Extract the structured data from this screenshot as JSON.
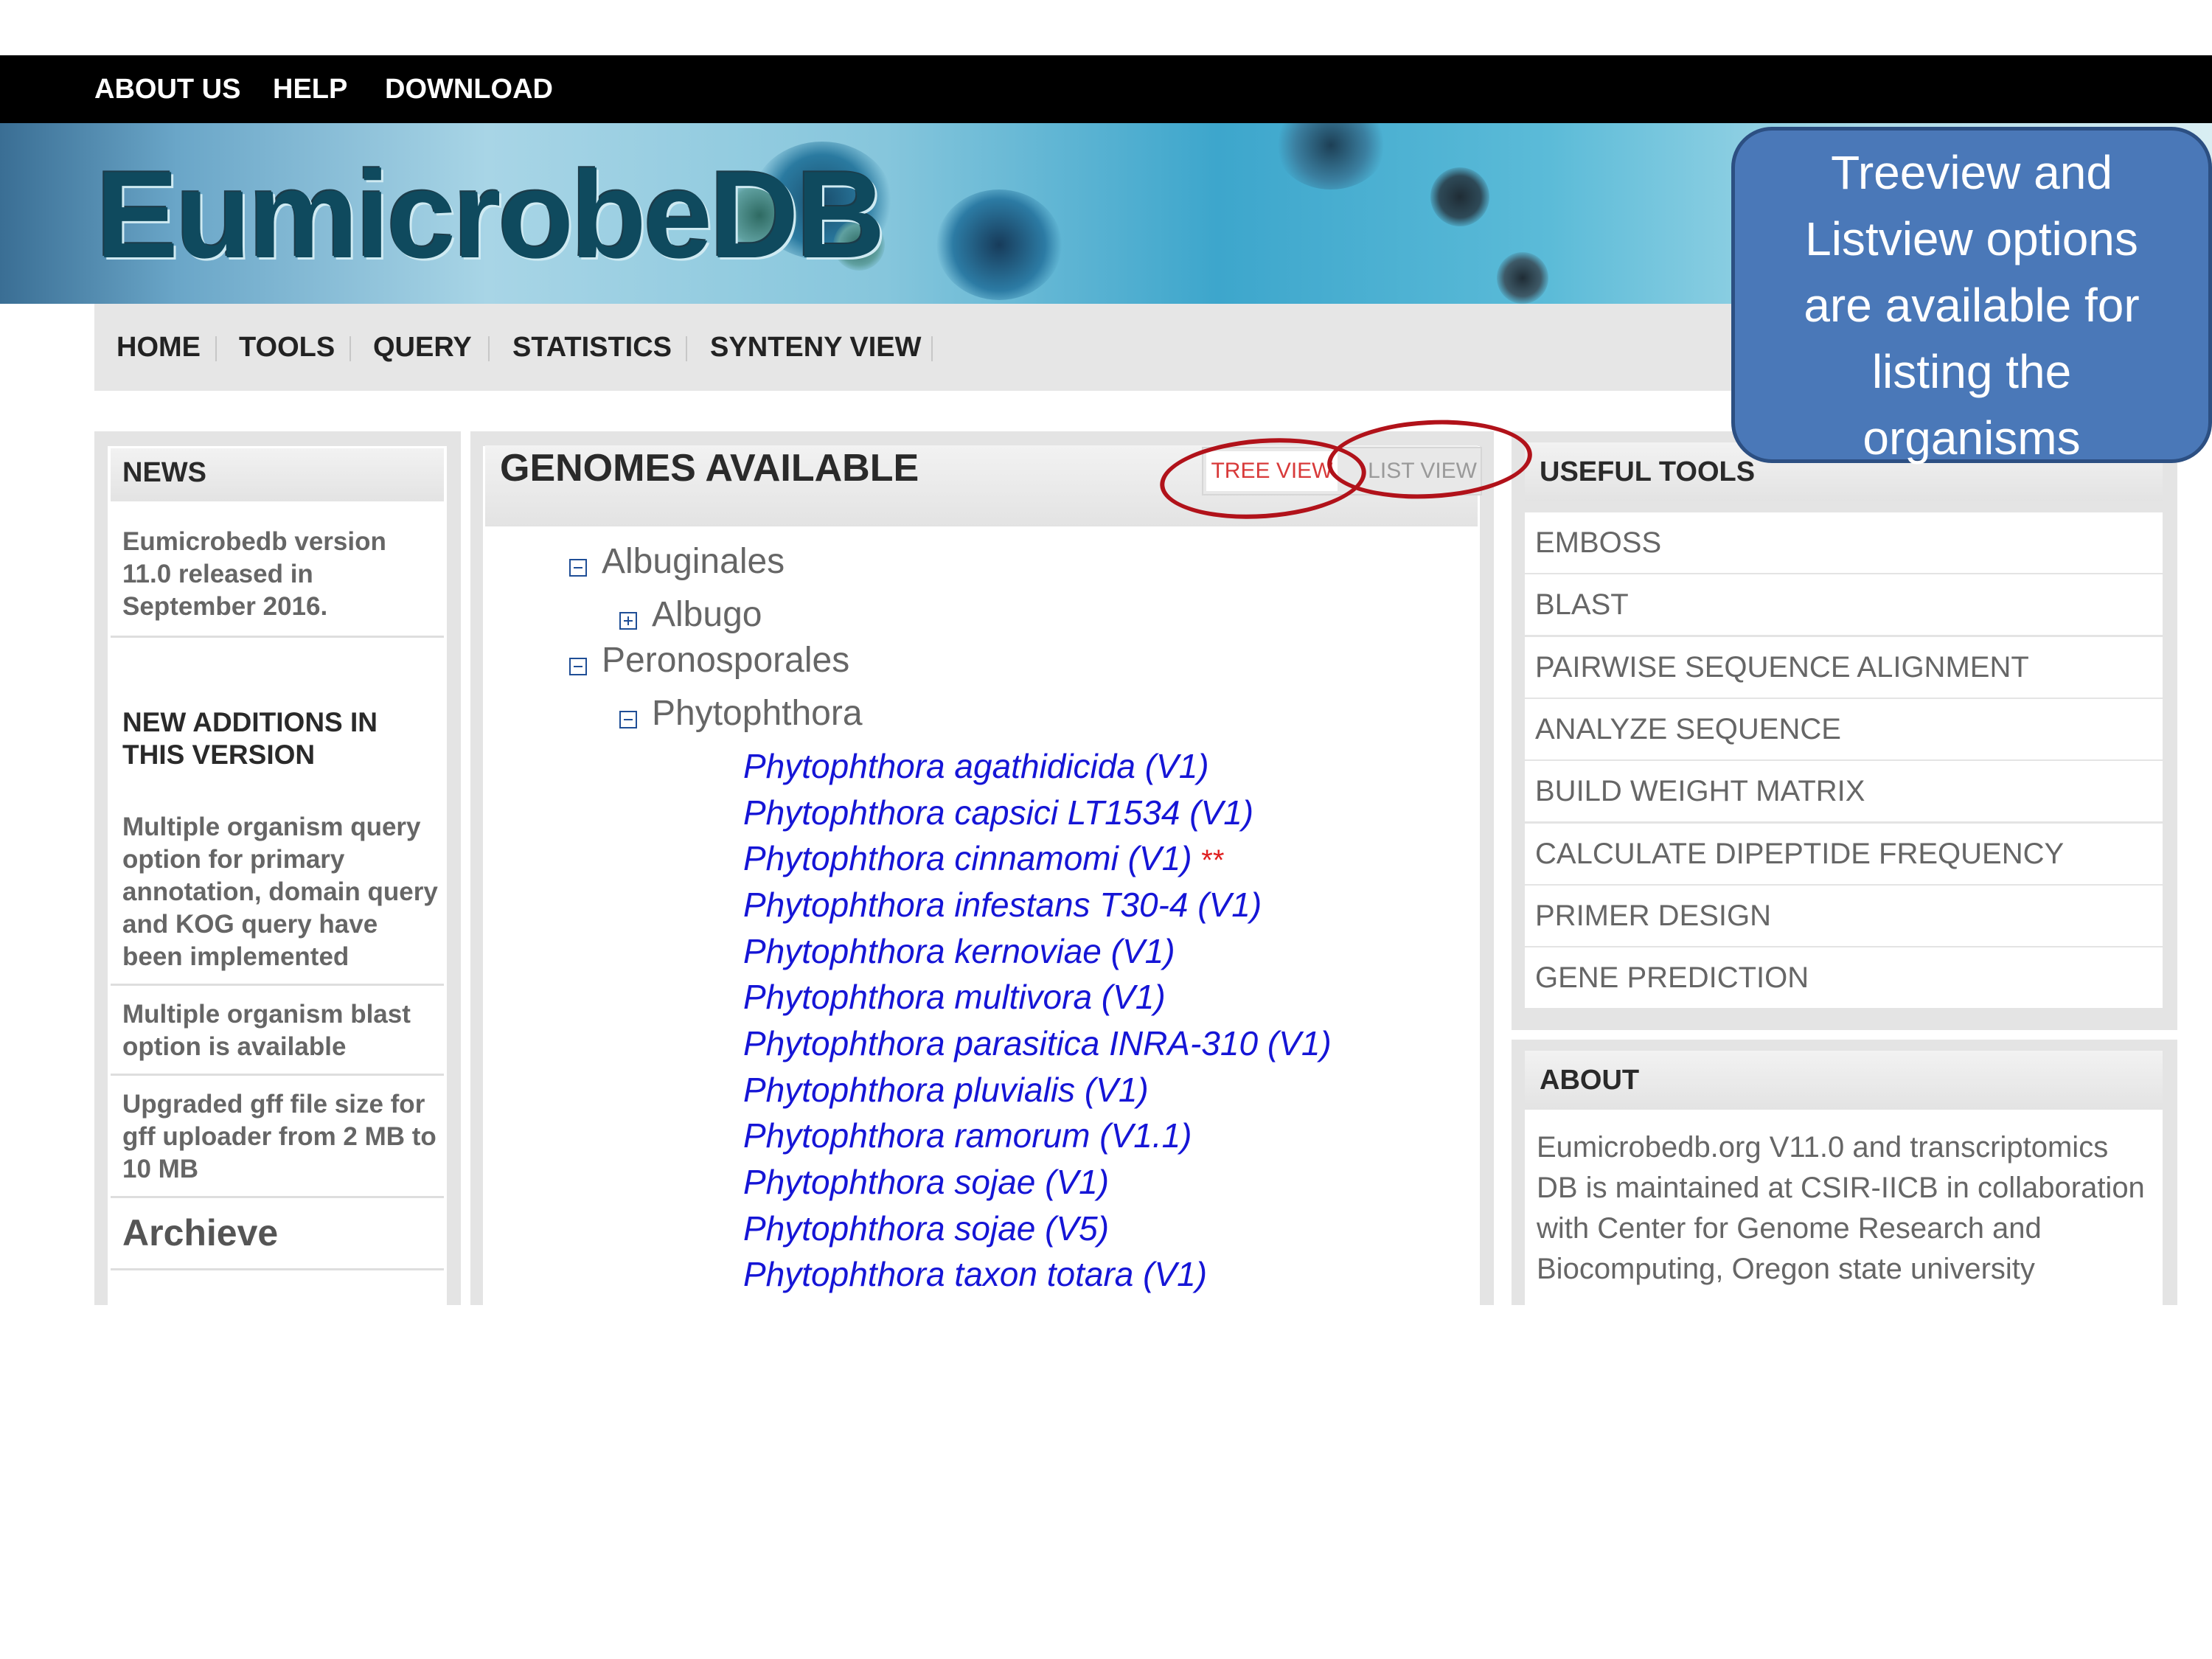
{
  "topbar": {
    "items": [
      "ABOUT US",
      "HELP",
      "DOWNLOAD"
    ]
  },
  "logo": "EumicrobeDB",
  "nav": {
    "items": [
      "HOME",
      "TOOLS",
      "QUERY",
      "STATISTICS",
      "SYNTENY VIEW"
    ]
  },
  "news": {
    "title": "NEWS",
    "release": "Eumicrobedb version 11.0 released in September 2016.",
    "additions_title": "NEW ADDITIONS IN THIS VERSION",
    "items": [
      "Multiple organism query option for primary annotation, domain query and KOG query have been implemented",
      "Multiple organism blast option is available",
      "Upgraded gff file size for gff uploader from 2 MB to 10 MB"
    ],
    "archive": "Archieve"
  },
  "genomes": {
    "title": "GENOMES AVAILABLE",
    "tree_view": "TREE VIEW",
    "list_view": "LIST VIEW",
    "tree": {
      "albuginales": "Albuginales",
      "albugo": "Albugo",
      "peronosporales": "Peronosporales",
      "phytophthora": "Phytophthora"
    },
    "species": [
      "Phytophthora agathidicida (V1)",
      "Phytophthora capsici LT1534 (V1)",
      "Phytophthora cinnamomi (V1)",
      "Phytophthora infestans T30-4 (V1)",
      "Phytophthora kernoviae (V1)",
      "Phytophthora multivora (V1)",
      "Phytophthora parasitica INRA-310 (V1)",
      "Phytophthora pluvialis (V1)",
      "Phytophthora ramorum (V1.1)",
      "Phytophthora sojae (V1)",
      "Phytophthora sojae (V5)",
      "Phytophthora taxon totara (V1)"
    ],
    "cinnamomi_marker": "**"
  },
  "tools": {
    "title": "USEFUL TOOLS",
    "items": [
      "EMBOSS",
      "BLAST",
      "PAIRWISE SEQUENCE ALIGNMENT",
      "ANALYZE SEQUENCE",
      "BUILD WEIGHT MATRIX",
      "CALCULATE DIPEPTIDE FREQUENCY",
      "PRIMER DESIGN",
      "GENE PREDICTION"
    ]
  },
  "about": {
    "title": "ABOUT",
    "text": "Eumicrobedb.org V11.0 and transcriptomics DB is maintained at CSIR-IICB in collaboration with Center for Genome Research and Biocomputing, Oregon state university"
  },
  "callout": {
    "lines": [
      "Treeview and",
      "Listview options",
      "are available for",
      "listing the",
      "organisms"
    ]
  },
  "colors": {
    "link": "#1515d6",
    "annotation_red": "#b1121a",
    "callout_fill": "#4a78b8"
  }
}
